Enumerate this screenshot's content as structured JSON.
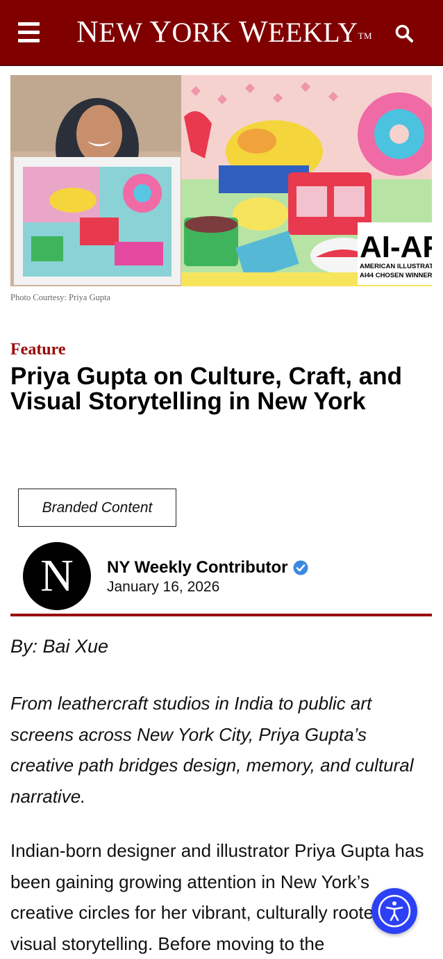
{
  "header": {
    "logo_first": "N",
    "logo_rest1": "EW ",
    "logo_y": "Y",
    "logo_rest2": "ORK ",
    "logo_w": "W",
    "logo_rest3": "EEKLY",
    "logo_tm": "TM"
  },
  "hero": {
    "badge_title": "AI-AP",
    "badge_line1": "AMERICAN ILLUSTRATION",
    "badge_line2": "AI44 CHOSEN WINNER",
    "caption": "Photo Courtesy: Priya Gupta"
  },
  "article": {
    "kicker": "Feature",
    "headline": "Priya Gupta on Culture, Craft, and Visual Storytelling in New York",
    "branded_label": "Branded Content",
    "avatar_letter": "N",
    "author_name": "NY Weekly Contributor",
    "date": "January 16, 2026",
    "byline": "By: Bai Xue",
    "dek": "From leathercraft studios in India to public art screens across New York City, Priya Gupta’s creative path bridges design, memory, and cultural narrative.",
    "body_first": "Indian-born designer and illustrator Priya Gupta has been gaining growing attention in New York’s creative circles for her vibrant, culturally rooted visual storytelling. Before moving to the"
  },
  "colors": {
    "brand": "#800000",
    "accent": "#9b0a0a",
    "a11y": "#2c41f5"
  },
  "icons": {
    "menu": "hamburger-menu-icon",
    "search": "search-icon",
    "verified": "verified-badge-icon",
    "accessibility": "accessibility-icon"
  }
}
